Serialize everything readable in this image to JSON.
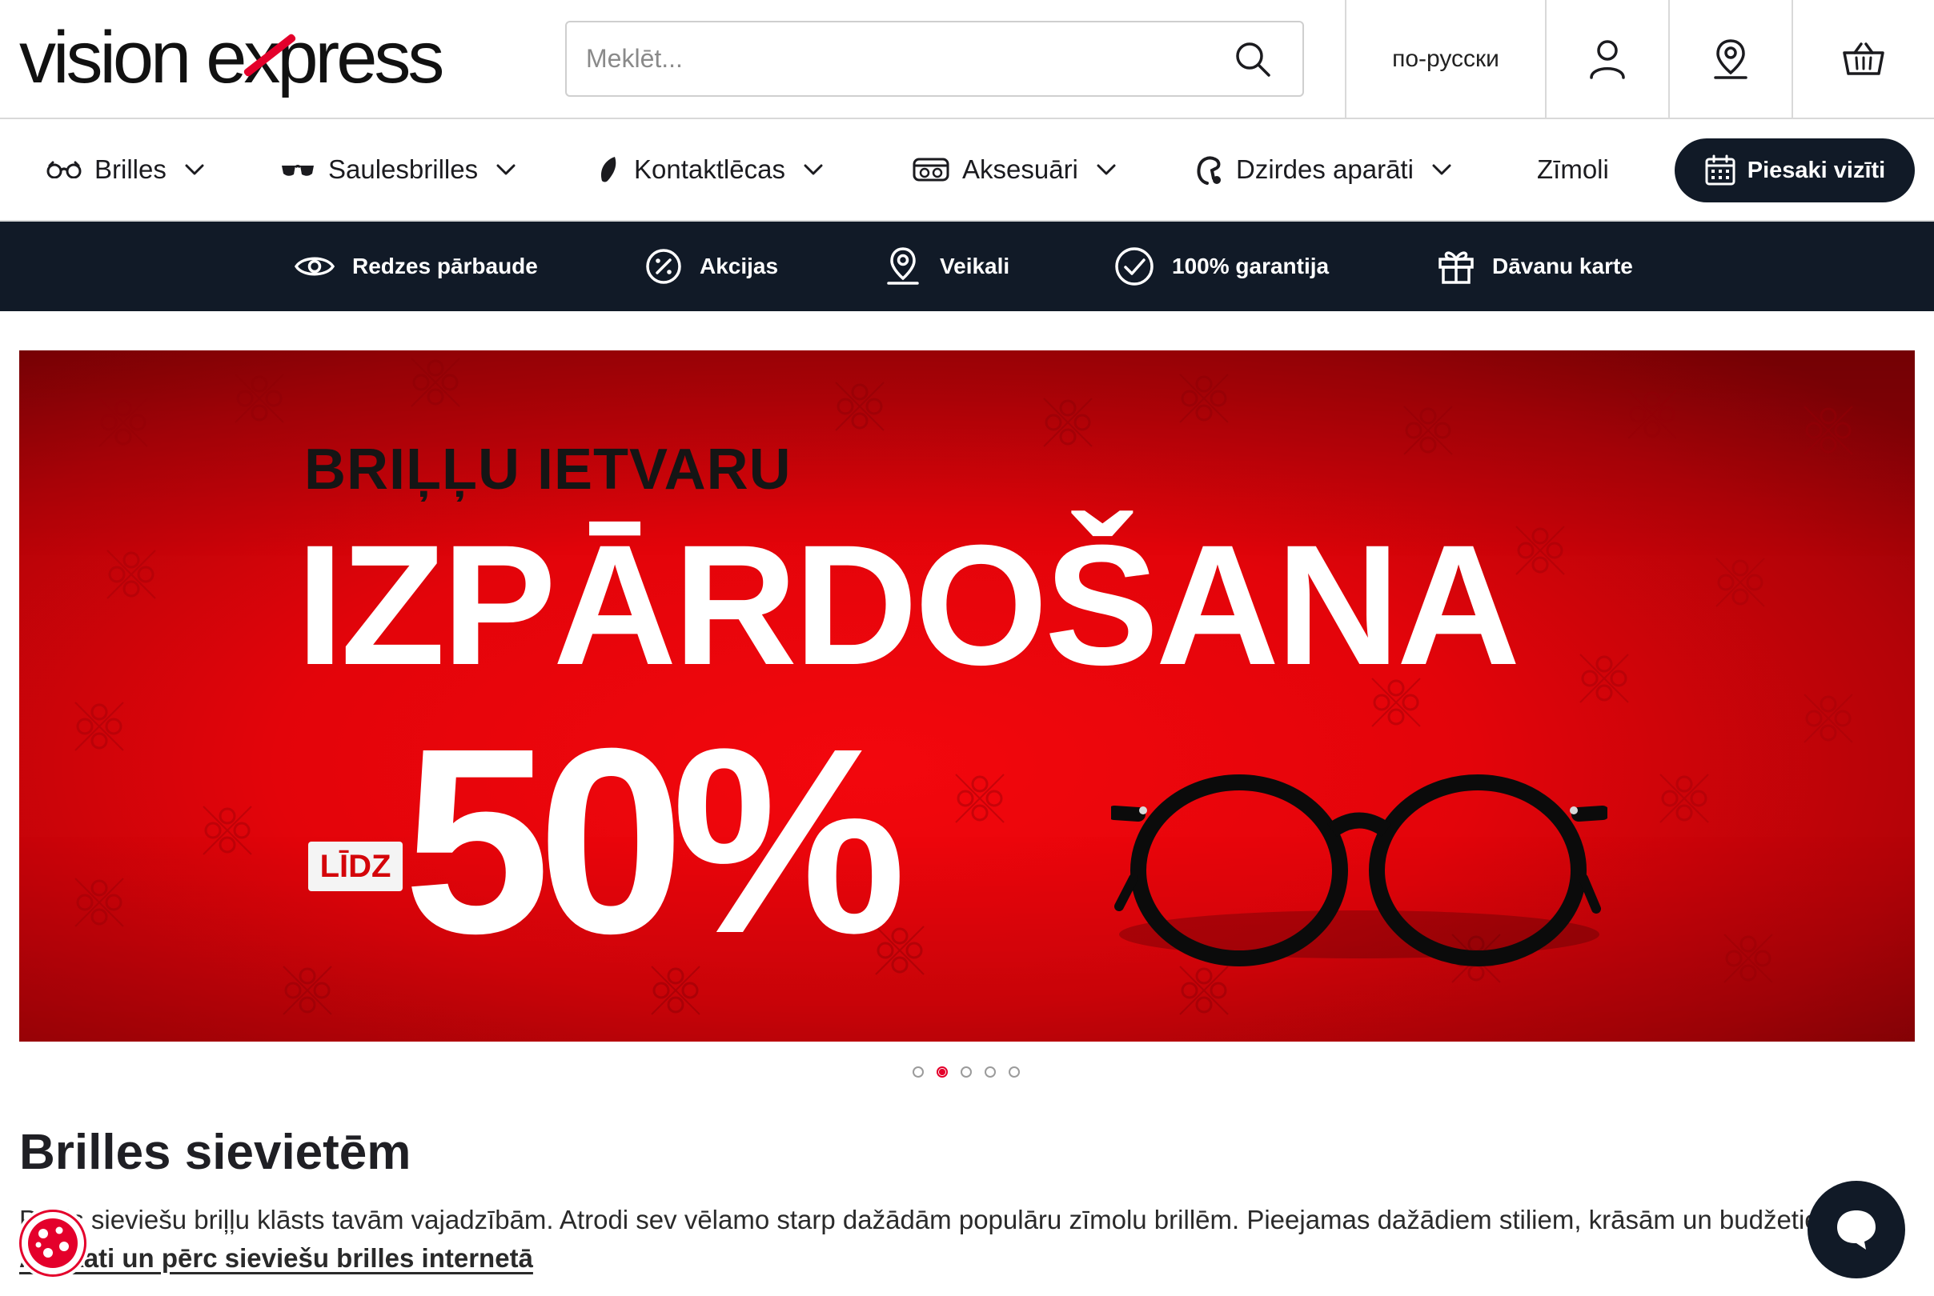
{
  "header": {
    "logo": {
      "word1": "vision",
      "word2_pre": "e",
      "word2_x": "x",
      "word2_post": "press"
    },
    "search": {
      "placeholder": "Meklēt...",
      "value": ""
    },
    "language": "по-русски",
    "icons": {
      "search": "search-icon",
      "account": "user-icon",
      "location": "map-pin-icon",
      "cart": "basket-icon"
    }
  },
  "nav": {
    "items": [
      {
        "label": "Brilles",
        "icon": "eyeglasses-icon",
        "has_dropdown": true
      },
      {
        "label": "Saulesbrilles",
        "icon": "sunglasses-icon",
        "has_dropdown": true
      },
      {
        "label": "Kontaktlēcas",
        "icon": "contact-lens-icon",
        "has_dropdown": true
      },
      {
        "label": "Aksesuāri",
        "icon": "glasses-case-icon",
        "has_dropdown": true
      },
      {
        "label": "Dzirdes aparāti",
        "icon": "hearing-aid-icon",
        "has_dropdown": true
      },
      {
        "label": "Zīmoli",
        "icon": "",
        "has_dropdown": false
      }
    ],
    "cta": "Piesaki vizīti"
  },
  "promo_bar": {
    "items": [
      {
        "label": "Redzes pārbaude",
        "icon": "eye-icon"
      },
      {
        "label": "Akcijas",
        "icon": "percent-badge-icon"
      },
      {
        "label": "Veikali",
        "icon": "map-pin-icon"
      },
      {
        "label": "100% garantija",
        "icon": "check-circle-icon"
      },
      {
        "label": "Dāvanu karte",
        "icon": "gift-icon"
      }
    ]
  },
  "banner": {
    "line1": "BRIĻĻU IETVARU",
    "line2": "IZPĀRDOŠANA",
    "badge": "LĪDZ",
    "percent": "50%",
    "carousel": {
      "count": 5,
      "active": 2
    }
  },
  "content": {
    "title": "Brilles sievietēm",
    "description": "Plašs sieviešu briļļu klāsts tavām vajadzībām. Atrodi sev vēlamo starp dažādām populāru zīmolu brillēm. Pieejamas dažādiem stiliem, krāsām un budžetiem.",
    "link": "Apskati un pērc sieviešu brilles internetā"
  },
  "colors": {
    "brand_red": "#e4002b",
    "navy": "#111a27",
    "banner_red": "#e3040a"
  },
  "floating": {
    "cookie": "cookie-icon",
    "chat": "chat-bubble-icon"
  }
}
